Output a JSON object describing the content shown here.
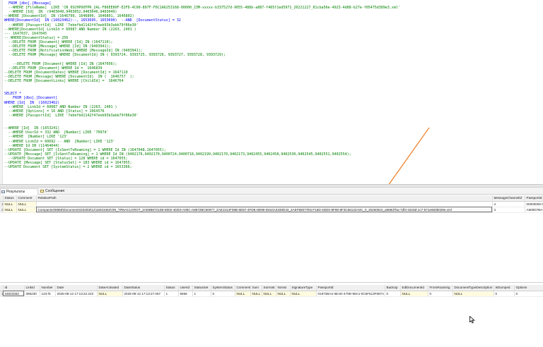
{
  "editor": {
    "lines": [
      {
        "t": "  FROM [dbo].[Message]",
        "c": "keyword"
      },
      {
        "t": "  --WHERE [FileName]  LIKE 'CN_0SCHPOOFPR_2AL-F86EE80F-E2FD-4C00-897F-F6C1A6253168-00000_23M-xxxxx-b337527d-9055-488b-a887-f465f1ed5971_20221227_81cba56e-4923-4d88-b27e-f05475d389e3.xml'",
        "c": "comment"
      },
      {
        "t": "  --WHERE [Id]  IN  (9403049,9403052,9403046,9403049)",
        "c": "comment"
      },
      {
        "t": "--WHERE [DocumentId]  IN (1646799, 1646800, 1646801, 1646802)",
        "c": "comment"
      },
      {
        "t": "WHERE[DocumentId]  IN (16023462)--, 1653695, 1653690)  --AND  [DocumentStatus] = 32",
        "c": "keyword"
      },
      {
        "t": "  --WHERE [PassportId]  LIKE '7ebefbd1142f47eeb93b3abb79f86e30'",
        "c": "comment"
      },
      {
        "t": "--WHERE[DocumentId] LinkId = 60087 AND Number IN (2263, 2401 )",
        "c": "comment"
      },
      {
        "t": "--- 1647037, 1647045",
        "c": "comment"
      },
      {
        "t": "-- WHERE[DocumentStatus] = 256",
        "c": "comment"
      },
      {
        "t": "  --DELETE FROM [Document] WHERE [Id] IN (1647110);",
        "c": "comment"
      },
      {
        "t": "  --DELETE FROM [Message] WHERE [Id] IN (9403941);",
        "c": "comment"
      },
      {
        "t": "  --DELETE FROM [NotificationWeb] WHERE [MessageId] IN (9403941);",
        "c": "comment"
      },
      {
        "t": "  --DELETE FROM [Message] WHERE [DocumentId] IN ( 9393724, 9393725, 9393726, 9393727, 9393728, 9393729);",
        "c": "comment"
      },
      {
        "t": "",
        "c": "plain"
      },
      {
        "t": "    --DELETE FROM [Document] WHERE [Id] IN (1647056);",
        "c": "comment"
      },
      {
        "t": "  --DELETE FROM [Document] WHERE Id =  1646839",
        "c": "comment"
      },
      {
        "t": "--DELETE FROM [DocumentDates] WHERE [DocumentId] = 1647110",
        "c": "comment"
      },
      {
        "t": "--DELETE FROM [Message] WHERE [DocumentId]  IN (  1646757  );",
        "c": "comment"
      },
      {
        "t": "--DELETE FROM [DocumentLinks] WHERE [ChildId] =  1646764",
        "c": "comment"
      },
      {
        "t": "",
        "c": "plain"
      },
      {
        "t": "",
        "c": "plain"
      },
      {
        "t": "SELECT *",
        "c": "keyword"
      },
      {
        "t": "    FROM [dbo].[Document]",
        "c": "keyword"
      },
      {
        "t": "WHERE [Id]  IN  (16023462)",
        "c": "keyword"
      },
      {
        "t": "  --WHERE  LinkId = 60087 AND Number IN (2263, 2401 )",
        "c": "comment"
      },
      {
        "t": "  --WHERE [Options] = 16 AND [Status] = 1064576",
        "c": "comment"
      },
      {
        "t": "  --WHERE [PassportId]  LIKE '7ebefbd1142f47eeb93b3abb79f86e30'",
        "c": "comment"
      },
      {
        "t": "",
        "c": "plain"
      },
      {
        "t": "",
        "c": "plain"
      },
      {
        "t": "--WHERE [Id]  IN (1653241)",
        "c": "comment"
      },
      {
        "t": "  --WHERE UserId = 332 AND  [Number] LIKE '70974'",
        "c": "comment"
      },
      {
        "t": "  --WHERE  [Number] LIKE '123'",
        "c": "comment"
      },
      {
        "t": "  --WHERE LinkId = 60692 -- AND  [Number] LIKE '123'",
        "c": "comment"
      },
      {
        "t": "  --WHERE Id IN (11464044)",
        "c": "comment"
      },
      {
        "t": "--UPDATE [Document] SET [IsSentToRoaming] = 1 WHERE Id IN (1647048,1647055);",
        "c": "comment"
      },
      {
        "t": "--UPDATE [Message] SET [IsSentToRoaming] = 1 WHERE Id IN (9402176,9402170,9400724,9400718,9402199,9402170,9402173,9402455,9402458,9402530,9402545,9402551,9402554);",
        "c": "comment"
      },
      {
        "t": "  --UPDATE Document SET [Status] = 128 WHERE id = 1647055;",
        "c": "comment"
      },
      {
        "t": "--UPDATE [Message] SET [StatusSet] = 183 WHERE id = 1647055;",
        "c": "comment"
      },
      {
        "t": "--UPDATE Document SET [SystemStatus] = 2 WHERE id = 1653366;",
        "c": "comment"
      }
    ]
  },
  "tabs": {
    "results": "Результаты",
    "messages": "Сообщения"
  },
  "grid1": {
    "columns": [
      "",
      "Status",
      "Comment",
      "RelativePath",
      "MessageChannelId",
      "PassportId"
    ],
    "rows": [
      {
        "n": "1",
        "cells": [
          "NULL",
          "NULL",
          "",
          "4",
          "00000000-00..."
        ]
      },
      {
        "n": "2",
        "cells": [
          "NULL",
          "NULL",
          "Companies\\8865\\Documents\\2025\\8\\12\\16023462\\ON_TRNACLGROT_2AE6B8721D8-8002-4DD3-A05C-A8872BC60977_2AE1314F39B-5D57-4FDE-8D99-D610A3330D43_2AEF58077E5-F16D-4DD0-8F88-8F3C56122A0C_0_20250810_a588d7ba-7df4-4319d-1c7-571e683b029e.xml",
          "4",
          "A500D7BA-..."
        ]
      }
    ]
  },
  "grid2": {
    "columns": [
      "",
      "Id",
      "LinkId",
      "Number",
      "Date",
      "DateActivated",
      "DateStatus",
      "Status",
      "UserId",
      "StatusSet",
      "SystemStatus",
      "Comment",
      "Sum",
      "SumVat",
      "NoVat",
      "SignatureType",
      "PassportId",
      "BackUp",
      "EdiDocumentId",
      "FromRoaming",
      "DocumentTypeDescription",
      "IsDumped",
      "Options"
    ],
    "rows": [
      {
        "n": "1",
        "cells": [
          "16023462",
          "396230",
          "123-/5",
          "2025-08-12 17:13:22.223",
          "NULL",
          "2025-08-12 17:13:27.067",
          "1",
          "6656",
          "1",
          "0",
          "NULL",
          "NULL",
          "NULL",
          "NULL",
          "NULL",
          "01972BA4-3EAD-479D-98A1-0C5F613F697A",
          "0",
          "NULL",
          "0",
          "NULL",
          "0",
          "0"
        ]
      }
    ]
  },
  "colors": {
    "comment": "#008000",
    "keyword": "#0000ff",
    "null_cell": "#fffbe0",
    "arrow": "#f08a3c"
  },
  "icons": {
    "results_tab": "grid-icon",
    "messages_tab": "message-icon",
    "cursor": "mouse-pointer-icon"
  }
}
